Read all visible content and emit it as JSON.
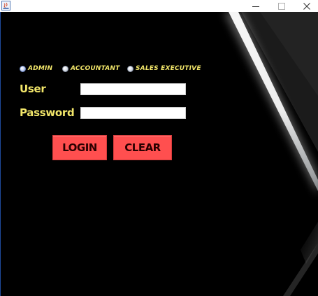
{
  "window": {
    "title": "",
    "controls": {
      "minimize_icon": "minimize-icon",
      "maximize_icon": "maximize-icon",
      "close_icon": "close-icon"
    }
  },
  "login_form": {
    "roles": [
      {
        "label": "ADMIN",
        "selected": true
      },
      {
        "label": "ACCOUNTANT",
        "selected": false
      },
      {
        "label": "SALES EXECUTIVE",
        "selected": false
      }
    ],
    "user_label": "User",
    "user_value": "",
    "password_label": "Password",
    "password_value": "",
    "login_label": "LOGIN",
    "clear_label": "CLEAR"
  },
  "colors": {
    "background": "#000000",
    "label_yellow": "#f2e66a",
    "button_red": "#ff4f4f",
    "button_text": "#2a0000"
  }
}
